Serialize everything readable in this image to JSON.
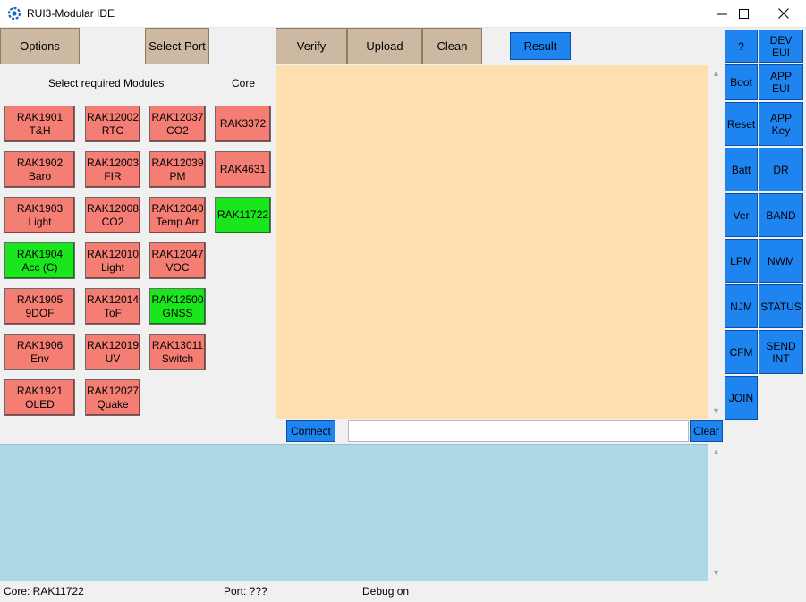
{
  "window": {
    "title": "RUI3-Modular IDE",
    "minimize_glyph": "—",
    "maximize_glyph": "☐",
    "close_glyph": "✕"
  },
  "toolbar": {
    "options": "Options",
    "select_port": "Select Port",
    "verify": "Verify",
    "upload": "Upload",
    "clean": "Clean",
    "result": "Result"
  },
  "labels": {
    "modules_heading": "Select required Modules",
    "core_heading": "Core"
  },
  "modules": [
    {
      "name": "RAK1901\nT&H",
      "state": "off"
    },
    {
      "name": "RAK1902\nBaro",
      "state": "off"
    },
    {
      "name": "RAK1903\nLight",
      "state": "off"
    },
    {
      "name": "RAK1904\nAcc (C)",
      "state": "on"
    },
    {
      "name": "RAK1905\n9DOF",
      "state": "off"
    },
    {
      "name": "RAK1906\nEnv",
      "state": "off"
    },
    {
      "name": "RAK1921\nOLED",
      "state": "off"
    },
    {
      "name": "RAK12002\nRTC",
      "state": "off"
    },
    {
      "name": "RAK12003\nFIR",
      "state": "off"
    },
    {
      "name": "RAK12008\nCO2",
      "state": "off"
    },
    {
      "name": "RAK12010\nLight",
      "state": "off"
    },
    {
      "name": "RAK12014\nToF",
      "state": "off"
    },
    {
      "name": "RAK12019\nUV",
      "state": "off"
    },
    {
      "name": "RAK12027\nQuake",
      "state": "off"
    },
    {
      "name": "RAK12037\nCO2",
      "state": "off"
    },
    {
      "name": "RAK12039\nPM",
      "state": "off"
    },
    {
      "name": "RAK12040\nTemp Arr",
      "state": "off"
    },
    {
      "name": "RAK12047\nVOC",
      "state": "off"
    },
    {
      "name": "RAK12500\nGNSS",
      "state": "on"
    },
    {
      "name": "RAK13011\nSwitch",
      "state": "off"
    }
  ],
  "cores": [
    {
      "name": "RAK3372",
      "state": "off"
    },
    {
      "name": "RAK4631",
      "state": "off"
    },
    {
      "name": "RAK11722",
      "state": "on"
    }
  ],
  "at_commands": [
    "?",
    "DEV\nEUI",
    "Boot",
    "APP\nEUI",
    "Reset",
    "APP\nKey",
    "Batt",
    "DR",
    "Ver",
    "BAND",
    "LPM",
    "NWM",
    "NJM",
    "STATUS",
    "CFM",
    "SEND\nINT",
    "JOIN"
  ],
  "serial": {
    "connect": "Connect",
    "clear": "Clear",
    "input_value": ""
  },
  "status_bar": {
    "core": "Core: RAK11722",
    "port": "Port: ???",
    "debug": "Debug on"
  },
  "colors": {
    "module_off": "#f47e73",
    "module_on": "#19e61d",
    "result_bg": "#ffdeb0",
    "log_bg": "#add8e6",
    "accent_blue": "#1e84f0",
    "toolbar_tan": "#cdb8a1"
  }
}
